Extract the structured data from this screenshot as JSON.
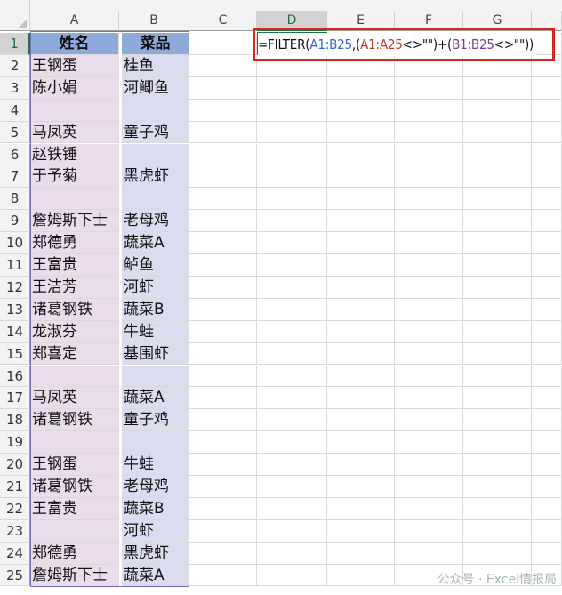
{
  "columns": [
    "A",
    "B",
    "C",
    "D",
    "E",
    "F",
    "G"
  ],
  "selected_column": "D",
  "formula": {
    "prefix": "=FILTER(",
    "ref1": "A1:B25",
    "comma": ",(",
    "ref2": "A1:A25",
    "mid": "<>\"\")+(",
    "ref3": "B1:B25",
    "suffix": "<>\"\"))"
  },
  "rows": [
    {
      "n": "1",
      "a": "姓名",
      "b": "菜品"
    },
    {
      "n": "2",
      "a": "王钢蛋",
      "b": "桂鱼"
    },
    {
      "n": "3",
      "a": "陈小娟",
      "b": "河鲫鱼"
    },
    {
      "n": "4",
      "a": "",
      "b": ""
    },
    {
      "n": "5",
      "a": "马凤英",
      "b": "童子鸡"
    },
    {
      "n": "6",
      "a": "赵铁锤",
      "b": ""
    },
    {
      "n": "7",
      "a": "于予菊",
      "b": "黑虎虾"
    },
    {
      "n": "8",
      "a": "",
      "b": ""
    },
    {
      "n": "9",
      "a": "詹姆斯下士",
      "b": "老母鸡"
    },
    {
      "n": "10",
      "a": "郑德勇",
      "b": "蔬菜A"
    },
    {
      "n": "11",
      "a": "王富贵",
      "b": "鲈鱼"
    },
    {
      "n": "12",
      "a": "王洁芳",
      "b": "河虾"
    },
    {
      "n": "13",
      "a": "诸葛钢铁",
      "b": "蔬菜B"
    },
    {
      "n": "14",
      "a": "龙淑芬",
      "b": "牛蛙"
    },
    {
      "n": "15",
      "a": "郑喜定",
      "b": "基围虾"
    },
    {
      "n": "16",
      "a": "",
      "b": ""
    },
    {
      "n": "17",
      "a": "马凤英",
      "b": "蔬菜A"
    },
    {
      "n": "18",
      "a": "诸葛钢铁",
      "b": "童子鸡"
    },
    {
      "n": "19",
      "a": "",
      "b": ""
    },
    {
      "n": "20",
      "a": "王钢蛋",
      "b": "牛蛙"
    },
    {
      "n": "21",
      "a": "诸葛钢铁",
      "b": "老母鸡"
    },
    {
      "n": "22",
      "a": "王富贵",
      "b": "蔬菜B"
    },
    {
      "n": "23",
      "a": "",
      "b": "河虾"
    },
    {
      "n": "24",
      "a": "郑德勇",
      "b": "黑虎虾"
    },
    {
      "n": "25",
      "a": "詹姆斯下士",
      "b": "蔬菜A"
    }
  ],
  "watermark": "公众号 · Excel情报局"
}
